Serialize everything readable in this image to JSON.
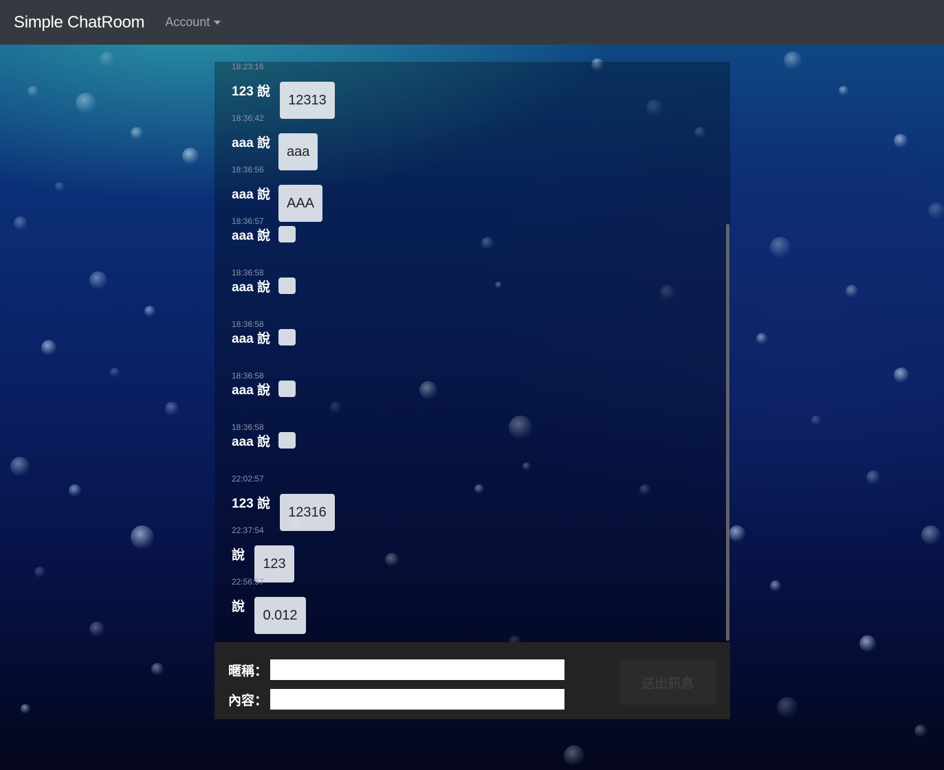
{
  "navbar": {
    "brand": "Simple ChatRoom",
    "account_label": "Account"
  },
  "messages": [
    {
      "time": "18:23:16",
      "sender": "123 說",
      "text": "12313"
    },
    {
      "time": "18:36:42",
      "sender": "aaa 說",
      "text": "aaa"
    },
    {
      "time": "18:36:56",
      "sender": "aaa 說",
      "text": "AAA"
    },
    {
      "time": "18:36:57",
      "sender": "aaa 說",
      "text": ""
    },
    {
      "time": "18:36:58",
      "sender": "aaa 說",
      "text": ""
    },
    {
      "time": "18:36:58",
      "sender": "aaa 說",
      "text": ""
    },
    {
      "time": "18:36:58",
      "sender": "aaa 說",
      "text": ""
    },
    {
      "time": "18:36:58",
      "sender": "aaa 說",
      "text": ""
    },
    {
      "time": "22:02:57",
      "sender": "123 說",
      "text": "12316"
    },
    {
      "time": "22:37:54",
      "sender": "說",
      "text": "123"
    },
    {
      "time": "22:56:57",
      "sender": "說",
      "text": "0.012"
    }
  ],
  "form": {
    "nickname_label": "暱稱：",
    "nickname_value": "",
    "content_label": "內容：",
    "content_value": "",
    "send_label": "送出訊息"
  },
  "colors": {
    "navbar": "#343a40",
    "bubble": "#e6eaf0",
    "form_bar": "#232323"
  },
  "icons": {
    "account_caret": "chevron-down-icon"
  }
}
